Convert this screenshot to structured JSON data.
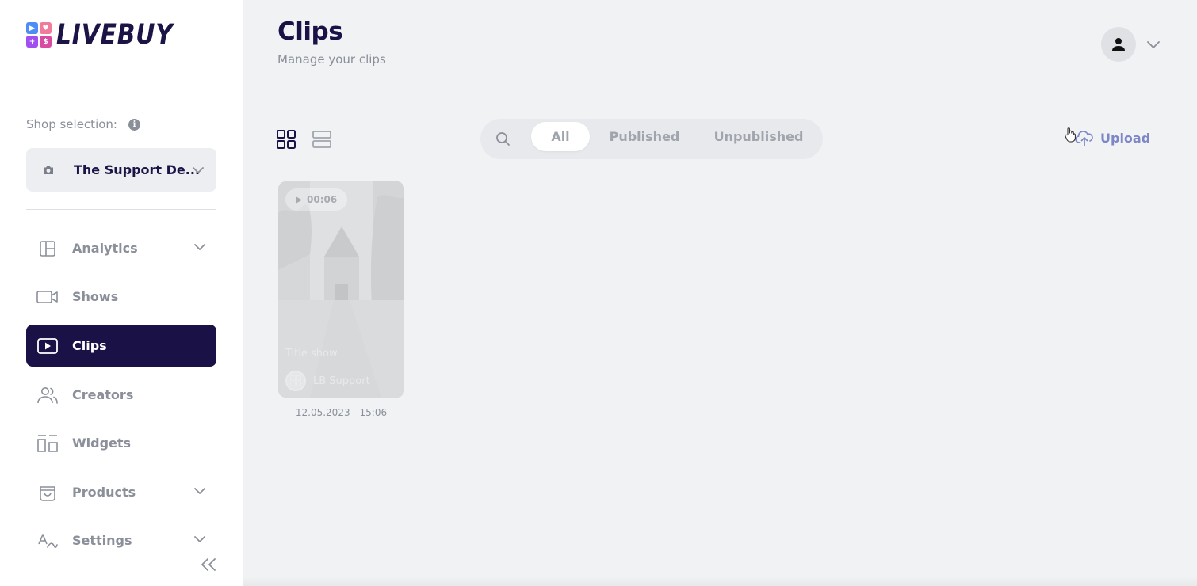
{
  "app": {
    "logo_text": "LIVEBUY",
    "logo_glyphs": [
      "▶",
      "♥",
      "+",
      "$"
    ]
  },
  "sidebar": {
    "shop_label": "Shop selection:",
    "shop_name": "The Support De...",
    "items": [
      {
        "label": "Analytics",
        "icon": "analytics-icon",
        "expandable": true,
        "active": false
      },
      {
        "label": "Shows",
        "icon": "video-camera-icon",
        "expandable": false,
        "active": false
      },
      {
        "label": "Clips",
        "icon": "play-clip-icon",
        "expandable": false,
        "active": true
      },
      {
        "label": "Creators",
        "icon": "users-icon",
        "expandable": false,
        "active": false
      },
      {
        "label": "Widgets",
        "icon": "widgets-icon",
        "expandable": false,
        "active": false
      },
      {
        "label": "Products",
        "icon": "shopping-bag-icon",
        "expandable": true,
        "active": false
      },
      {
        "label": "Settings",
        "icon": "translate-icon",
        "expandable": true,
        "active": false
      }
    ]
  },
  "header": {
    "title": "Clips",
    "subtitle": "Manage your clips"
  },
  "filters": {
    "tabs": [
      "All",
      "Published",
      "Unpublished"
    ],
    "selected": "All"
  },
  "toolbar": {
    "upload_label": "Upload"
  },
  "clips": [
    {
      "duration": "00:06",
      "title": "Title show",
      "author": "LB Support",
      "date": "12.05.2023 - 15:06"
    }
  ],
  "colors": {
    "brand_dark": "#1a1147",
    "muted": "#8a8f99",
    "accent": "#7d86c7",
    "background": "#f1f2f4"
  }
}
